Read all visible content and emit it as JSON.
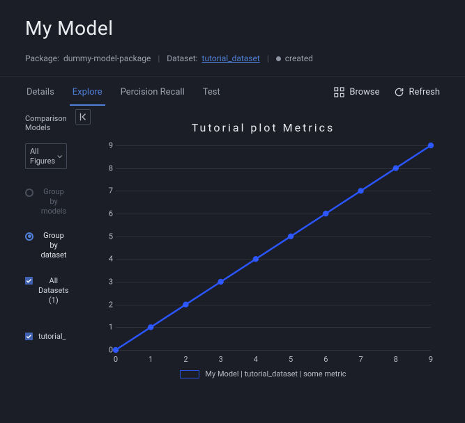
{
  "header": {
    "title": "My Model",
    "package_prefix": "Package:",
    "package_name": "dummy-model-package",
    "dataset_prefix": "Dataset:",
    "dataset_name": "tutorial_dataset",
    "status": "created"
  },
  "tabs": {
    "details": "Details",
    "explore": "Explore",
    "percision": "Percision Recall",
    "test": "Test",
    "active": "explore"
  },
  "toolbar": {
    "browse": "Browse",
    "refresh": "Refresh"
  },
  "sidebar": {
    "heading": "Comparison Models",
    "dropdown_label": "All Figures",
    "group_by_models": "Group by models",
    "group_by_dataset": "Group by dataset",
    "all_datasets": "All Datasets (1)",
    "dataset_item": "tutorial_"
  },
  "chart": {
    "title": "Tutorial plot Metrics",
    "legend": "My Model | tutorial_dataset | some metric"
  },
  "chart_data": {
    "type": "line",
    "title": "Tutorial plot Metrics",
    "x": [
      0,
      1,
      2,
      3,
      4,
      5,
      6,
      7,
      8,
      9
    ],
    "y": [
      0,
      1,
      2,
      3,
      4,
      5,
      6,
      7,
      8,
      9
    ],
    "xlabel": "",
    "ylabel": "",
    "xlim": [
      0,
      9
    ],
    "ylim": [
      0,
      9
    ],
    "series": [
      {
        "name": "My Model | tutorial_dataset | some metric",
        "x": [
          0,
          1,
          2,
          3,
          4,
          5,
          6,
          7,
          8,
          9
        ],
        "y": [
          0,
          1,
          2,
          3,
          4,
          5,
          6,
          7,
          8,
          9
        ],
        "color": "#2b55ff"
      }
    ]
  }
}
